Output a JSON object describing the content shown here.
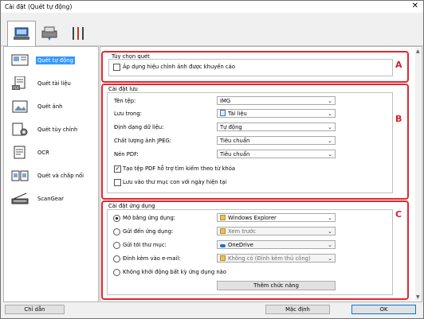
{
  "window": {
    "title": "Cài đặt (Quét tự động)"
  },
  "top_tabs": [
    {
      "icon": "scan-from-computer-icon"
    },
    {
      "icon": "scan-from-panel-icon"
    },
    {
      "icon": "tools-icon"
    }
  ],
  "sidebar": {
    "items": [
      {
        "label": "Quét tự động",
        "icon": "auto-scan-icon",
        "selected": true
      },
      {
        "label": "Quét tài liệu",
        "icon": "document-scan-icon"
      },
      {
        "label": "Quét ảnh",
        "icon": "photo-scan-icon"
      },
      {
        "label": "Quét tùy chỉnh",
        "icon": "custom-scan-icon"
      },
      {
        "label": "OCR",
        "icon": "ocr-icon"
      },
      {
        "label": "Quét và chắp nối",
        "icon": "scan-stitch-icon"
      },
      {
        "label": "ScanGear",
        "icon": "scangear-icon"
      }
    ]
  },
  "scan_options": {
    "title": "Tùy chọn quét",
    "letter": "A",
    "apply_correction": "Áp dụng hiệu chỉnh ảnh được khuyến cáo"
  },
  "save_settings": {
    "title": "Cài đặt lưu",
    "letter": "B",
    "file_name_label": "Tên tệp:",
    "file_name_value": "IMG",
    "save_in_label": "Lưu trong:",
    "save_in_value": "Tài liệu",
    "data_format_label": "Định dạng dữ liệu:",
    "data_format_value": "Tự động",
    "jpeg_quality_label": "Chất lượng ảnh JPEG:",
    "jpeg_quality_value": "Tiêu chuẩn",
    "pdf_compress_label": "Nén PDF:",
    "pdf_compress_value": "Tiêu chuẩn",
    "searchable_pdf": "Tạo tệp PDF hỗ trợ tìm kiếm theo từ khóa",
    "searchable_pdf_checked": true,
    "subfolder_date": "Lưu vào thư mục con với ngày hiện tại",
    "subfolder_date_checked": false
  },
  "app_settings": {
    "title": "Cài đặt ứng dụng",
    "letter": "C",
    "open_with_label": "Mở bằng ứng dụng:",
    "open_with_value": "Windows Explorer",
    "send_to_app_label": "Gửi đến ứng dụng:",
    "send_to_app_value": "Xem trước",
    "send_to_folder_label": "Gửi tới thư mục:",
    "send_to_folder_value": "OneDrive",
    "attach_email_label": "Đính kèm vào e-mail:",
    "attach_email_value": "Không có (Đính kèm thủ công)",
    "no_app_label": "Không khởi động bất kỳ ứng dụng nào",
    "add_function_button": "Thêm chức năng",
    "selected": "open_with"
  },
  "footer": {
    "instructions": "Chỉ dẫn",
    "defaults": "Mặc định",
    "ok": "OK"
  },
  "colors": {
    "accent": "#3399ff",
    "callout": "#e3262d"
  }
}
